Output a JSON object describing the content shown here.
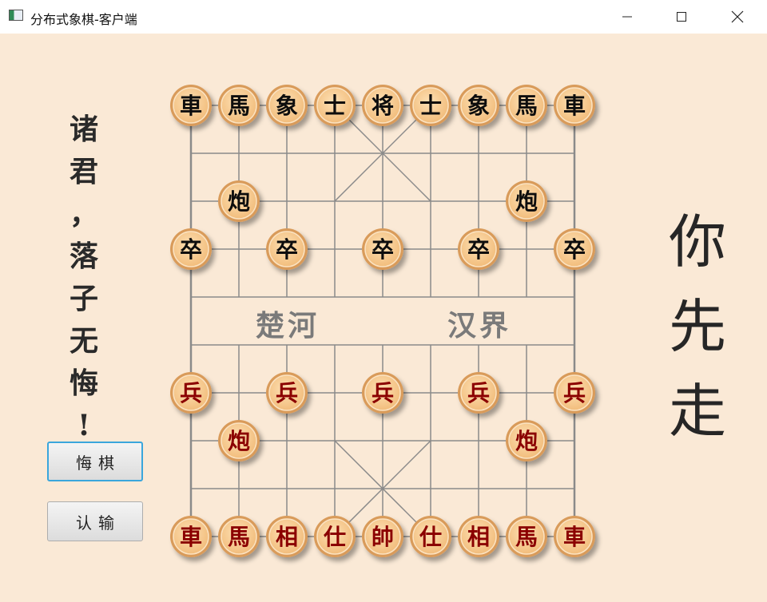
{
  "window": {
    "title": "分布式象棋-客户端",
    "minimize_icon": "minimize-icon",
    "maximize_icon": "maximize-icon",
    "close_icon": "close-icon"
  },
  "slogan": [
    "诸",
    "君",
    "，",
    "落",
    "子",
    "无",
    "悔",
    "!"
  ],
  "turn_indicator": [
    "你",
    "先",
    "走"
  ],
  "buttons": {
    "undo": "悔棋",
    "resign": "认输"
  },
  "board": {
    "river_left": "楚河",
    "river_right": "汉界",
    "pieces": [
      {
        "ch": "車",
        "side": "black",
        "col": 0,
        "row": 0
      },
      {
        "ch": "馬",
        "side": "black",
        "col": 1,
        "row": 0
      },
      {
        "ch": "象",
        "side": "black",
        "col": 2,
        "row": 0
      },
      {
        "ch": "士",
        "side": "black",
        "col": 3,
        "row": 0
      },
      {
        "ch": "将",
        "side": "black",
        "col": 4,
        "row": 0
      },
      {
        "ch": "士",
        "side": "black",
        "col": 5,
        "row": 0
      },
      {
        "ch": "象",
        "side": "black",
        "col": 6,
        "row": 0
      },
      {
        "ch": "馬",
        "side": "black",
        "col": 7,
        "row": 0
      },
      {
        "ch": "車",
        "side": "black",
        "col": 8,
        "row": 0
      },
      {
        "ch": "炮",
        "side": "black",
        "col": 1,
        "row": 2
      },
      {
        "ch": "炮",
        "side": "black",
        "col": 7,
        "row": 2
      },
      {
        "ch": "卒",
        "side": "black",
        "col": 0,
        "row": 3
      },
      {
        "ch": "卒",
        "side": "black",
        "col": 2,
        "row": 3
      },
      {
        "ch": "卒",
        "side": "black",
        "col": 4,
        "row": 3
      },
      {
        "ch": "卒",
        "side": "black",
        "col": 6,
        "row": 3
      },
      {
        "ch": "卒",
        "side": "black",
        "col": 8,
        "row": 3
      },
      {
        "ch": "兵",
        "side": "red",
        "col": 0,
        "row": 6
      },
      {
        "ch": "兵",
        "side": "red",
        "col": 2,
        "row": 6
      },
      {
        "ch": "兵",
        "side": "red",
        "col": 4,
        "row": 6
      },
      {
        "ch": "兵",
        "side": "red",
        "col": 6,
        "row": 6
      },
      {
        "ch": "兵",
        "side": "red",
        "col": 8,
        "row": 6
      },
      {
        "ch": "炮",
        "side": "red",
        "col": 1,
        "row": 7
      },
      {
        "ch": "炮",
        "side": "red",
        "col": 7,
        "row": 7
      },
      {
        "ch": "車",
        "side": "red",
        "col": 0,
        "row": 9
      },
      {
        "ch": "馬",
        "side": "red",
        "col": 1,
        "row": 9
      },
      {
        "ch": "相",
        "side": "red",
        "col": 2,
        "row": 9
      },
      {
        "ch": "仕",
        "side": "red",
        "col": 3,
        "row": 9
      },
      {
        "ch": "帥",
        "side": "red",
        "col": 4,
        "row": 9
      },
      {
        "ch": "仕",
        "side": "red",
        "col": 5,
        "row": 9
      },
      {
        "ch": "相",
        "side": "red",
        "col": 6,
        "row": 9
      },
      {
        "ch": "馬",
        "side": "red",
        "col": 7,
        "row": 9
      },
      {
        "ch": "車",
        "side": "red",
        "col": 8,
        "row": 9
      }
    ]
  },
  "colors": {
    "background": "#fae9d6",
    "grid": "#8a8a8a",
    "piece_fill": "#f7c98c",
    "piece_ring": "#d99b5a",
    "black_text": "#111111",
    "red_text": "#8b0000",
    "river_text": "#7a7a7a",
    "focus_border": "#3aa6dc"
  }
}
